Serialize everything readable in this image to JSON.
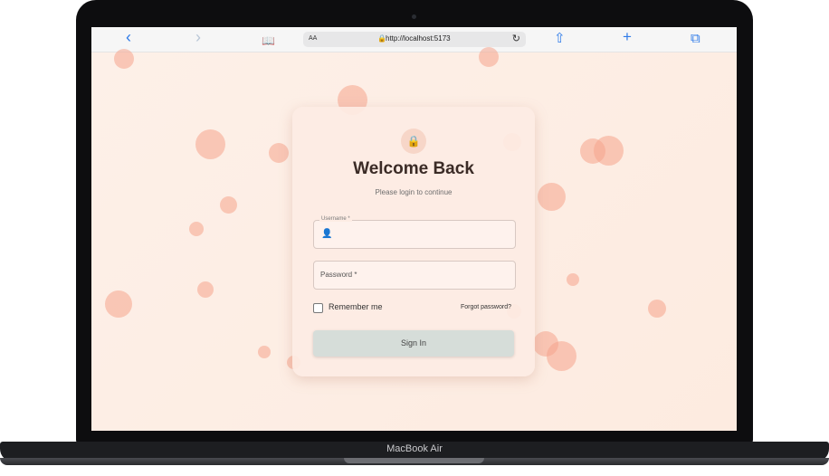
{
  "browser": {
    "back_icon": "‹",
    "forward_icon": "›",
    "bookmarks_icon": "📖",
    "aa_label": "AA",
    "lock_icon": "🔒",
    "url": "http://localhost:5173",
    "reload_icon": "↻",
    "share_icon": "⇧",
    "new_tab_icon": "+",
    "tabs_icon": "⧉"
  },
  "login": {
    "lock_icon": "🔒",
    "title": "Welcome Back",
    "subtitle": "Please login to continue",
    "username_label": "Username *",
    "user_icon": "👤",
    "password_placeholder": "Password *",
    "remember_label": "Remember me",
    "forgot_link": "Forgot password?",
    "signin_label": "Sign In"
  },
  "device": {
    "model_label": "MacBook Air"
  },
  "colors": {
    "background": "#fdeee5",
    "bubble": "#f6a48c",
    "accent": "#2f7be8",
    "button": "#d6ddd9"
  }
}
